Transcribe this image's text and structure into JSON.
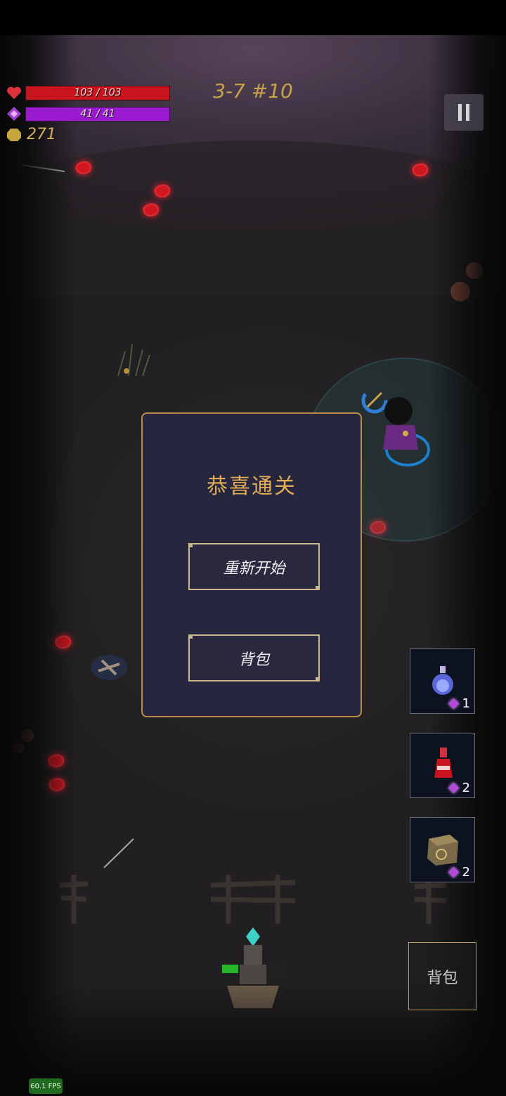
{
  "hud": {
    "hp": {
      "current": 103,
      "max": 103,
      "text": "103 / 103",
      "color": "#c8141c"
    },
    "mana": {
      "current": 41,
      "max": 41,
      "text": "41 / 41",
      "color": "#9a1ad0"
    },
    "gold": "271",
    "stage": "3-7 #10"
  },
  "dialog": {
    "title": "恭喜通关",
    "restart_label": "重新开始",
    "bag_label": "背包"
  },
  "items": [
    {
      "name": "blue-potion",
      "count": "1"
    },
    {
      "name": "red-potion",
      "count": "2"
    },
    {
      "name": "rune-cube",
      "count": "2"
    }
  ],
  "bag_button_label": "背包",
  "fps": "60.1 FPS",
  "tower_hp_fraction": 0.25,
  "colors": {
    "accent_gold": "#c8a24b",
    "dialog_bg": "#27263f",
    "dialog_border": "#b88b47"
  }
}
